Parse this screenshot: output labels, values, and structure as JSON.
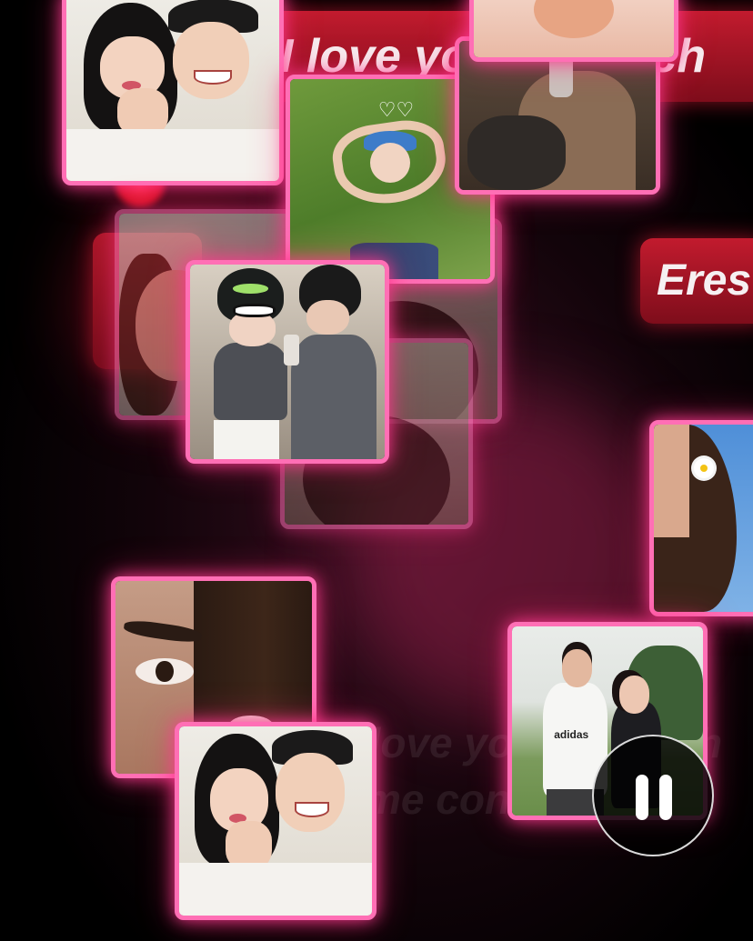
{
  "banners": {
    "top_text": "I love you so much",
    "right_text": "Eres"
  },
  "ghost_text": {
    "line1": "I love you so much",
    "line2": "me contas"
  },
  "grass_photo": {
    "doodle": "♡♡"
  },
  "park_photo": {
    "shirt_logo": "adidas"
  },
  "controls": {
    "pause_icon": "pause-icon"
  },
  "colors": {
    "frame": "#ff6fb5",
    "banner": "#c21b2e",
    "background": "#000000"
  }
}
